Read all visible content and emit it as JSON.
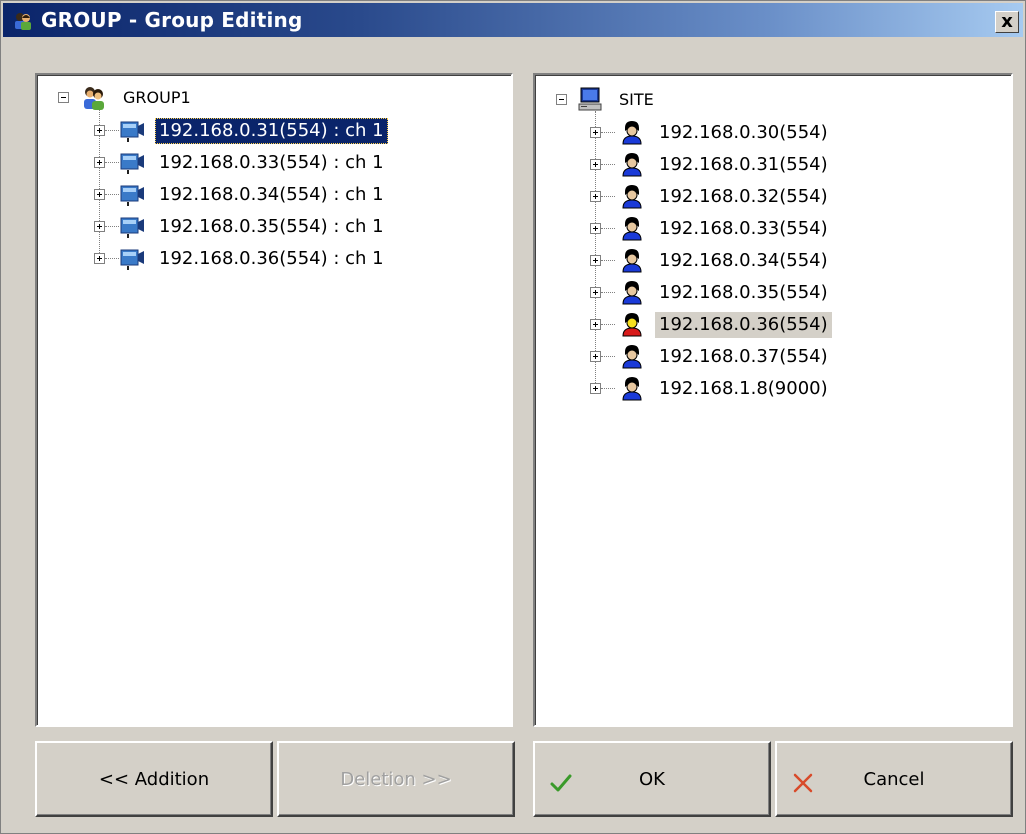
{
  "window": {
    "title": "GROUP - Group Editing",
    "close_label": "x"
  },
  "group_tree": {
    "root_label": "GROUP1",
    "items": [
      {
        "label": "192.168.0.31(554) : ch 1",
        "selected": true
      },
      {
        "label": "192.168.0.33(554) : ch 1"
      },
      {
        "label": "192.168.0.34(554) : ch 1"
      },
      {
        "label": "192.168.0.35(554) : ch 1"
      },
      {
        "label": "192.168.0.36(554) : ch 1"
      }
    ]
  },
  "site_tree": {
    "root_label": "SITE",
    "items": [
      {
        "label": "192.168.0.30(554)"
      },
      {
        "label": "192.168.0.31(554)"
      },
      {
        "label": "192.168.0.32(554)"
      },
      {
        "label": "192.168.0.33(554)"
      },
      {
        "label": "192.168.0.34(554)"
      },
      {
        "label": "192.168.0.35(554)"
      },
      {
        "label": "192.168.0.36(554)",
        "highlighted": true
      },
      {
        "label": "192.168.0.37(554)"
      },
      {
        "label": "192.168.1.8(9000)"
      }
    ]
  },
  "buttons": {
    "addition": "<< Addition",
    "deletion": "Deletion >>",
    "ok": "OK",
    "cancel": "Cancel"
  },
  "colors": {
    "title_gradient_start": "#0a246a",
    "title_gradient_end": "#a6caf0",
    "selection": "#0a246a",
    "dialog_face": "#d4d0c8",
    "ok_check": "#3a9a2a",
    "cancel_x": "#d84a2a"
  }
}
